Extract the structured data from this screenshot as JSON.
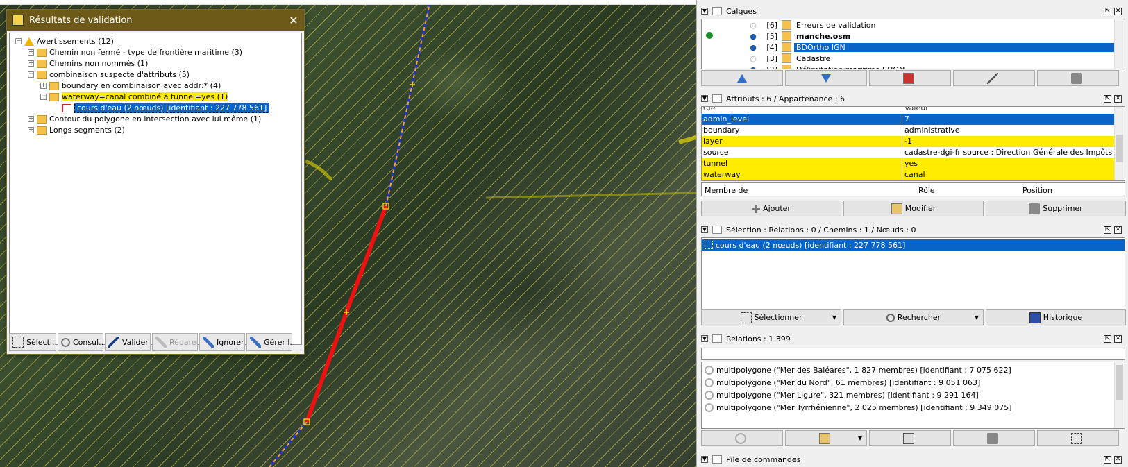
{
  "dialog": {
    "title": "Résultats de validation",
    "close": "✕",
    "tree": [
      {
        "label": "Avertissements (12)",
        "level": 0,
        "expander": "−",
        "icon": "warning-icon"
      },
      {
        "label": "Chemin non fermé - type de frontière maritime (3)",
        "level": 1,
        "expander": "+",
        "icon": "folder-icon"
      },
      {
        "label": "Chemins non nommés (1)",
        "level": 1,
        "expander": "+",
        "icon": "folder-icon"
      },
      {
        "label": "combinaison suspecte d'attributs (5)",
        "level": 1,
        "expander": "−",
        "icon": "folder-icon"
      },
      {
        "label": "boundary en combinaison avec addr:* (4)",
        "level": 2,
        "expander": "+",
        "icon": "folder-icon"
      },
      {
        "label": "waterway=canal combiné à tunnel=yes (1)",
        "level": 2,
        "expander": "−",
        "icon": "folder-icon"
      },
      {
        "label": "cours d'eau (2 nœuds) [identifiant : 227 778 561]",
        "level": 3,
        "expander": "",
        "icon": "way-icon",
        "selected": true
      },
      {
        "label": "Contour du polygone en intersection avec lui même (1)",
        "level": 1,
        "expander": "+",
        "icon": "folder-icon"
      },
      {
        "label": "Longs segments (2)",
        "level": 1,
        "expander": "+",
        "icon": "folder-icon"
      }
    ],
    "buttons": [
      {
        "label": "Sélecti...",
        "icon": "select-icon",
        "disabled": false
      },
      {
        "label": "Consul...",
        "icon": "lookup-icon",
        "disabled": false
      },
      {
        "label": "Valider",
        "icon": "check-icon",
        "disabled": false
      },
      {
        "label": "Réparer",
        "icon": "wrench-icon",
        "disabled": true
      },
      {
        "label": "Ignorer",
        "icon": "wrench-icon",
        "disabled": false
      },
      {
        "label": "Gérer l...",
        "icon": "wrench-icon",
        "disabled": false
      }
    ]
  },
  "layers": {
    "header": "Calques",
    "rows": [
      {
        "num": "[6]",
        "name": "Erreurs de validation",
        "visible": false,
        "bold": false,
        "selected": false,
        "active": false
      },
      {
        "num": "[5]",
        "name": "manche.osm",
        "visible": true,
        "bold": true,
        "selected": false,
        "active": true
      },
      {
        "num": "[4]",
        "name": "BDOrtho IGN",
        "visible": true,
        "bold": false,
        "selected": true,
        "active": false
      },
      {
        "num": "[3]",
        "name": "Cadastre",
        "visible": false,
        "bold": false,
        "selected": false,
        "active": false
      },
      {
        "num": "[2]",
        "name": "Délimitation maritime SHOM",
        "visible": true,
        "bold": false,
        "selected": false,
        "active": false
      }
    ]
  },
  "attributes": {
    "header": "Attributs : 6 / Appartenance : 6",
    "col_key": "Clé",
    "col_value": "Valeur",
    "rows": [
      {
        "key": "admin_level",
        "value": "7",
        "selected": true
      },
      {
        "key": "boundary",
        "value": "administrative"
      },
      {
        "key": "layer",
        "value": "-1"
      },
      {
        "key": "source",
        "value": "cadastre-dgi-fr source : Direction Générale des Impôts - Ca..."
      },
      {
        "key": "tunnel",
        "value": "yes"
      },
      {
        "key": "waterway",
        "value": "canal"
      }
    ],
    "member_cols": [
      "Membre de",
      "Rôle",
      "Position"
    ],
    "buttons": [
      "Ajouter",
      "Modifier",
      "Supprimer"
    ]
  },
  "selection": {
    "header": "Sélection : Relations : 0 / Chemins : 1 / Nœuds : 0",
    "item": "cours d'eau (2 nœuds) [identifiant : 227 778 561]",
    "buttons": [
      "Sélectionner",
      "Rechercher",
      "Historique"
    ]
  },
  "relations": {
    "header": "Relations : 1 399",
    "items": [
      "multipolygone (\"Mer des Baléares\", 1 827 membres) [identifiant : 7 075 622]",
      "multipolygone (\"Mer du Nord\", 61 membres) [identifiant : 9 051 063]",
      "multipolygone (\"Mer Ligure\", 321 membres) [identifiant : 9 291 164]",
      "multipolygone (\"Mer Tyrrhénienne\", 2 025 membres) [identifiant : 9 349 075]"
    ]
  },
  "commands": {
    "header": "Pile de commandes"
  }
}
